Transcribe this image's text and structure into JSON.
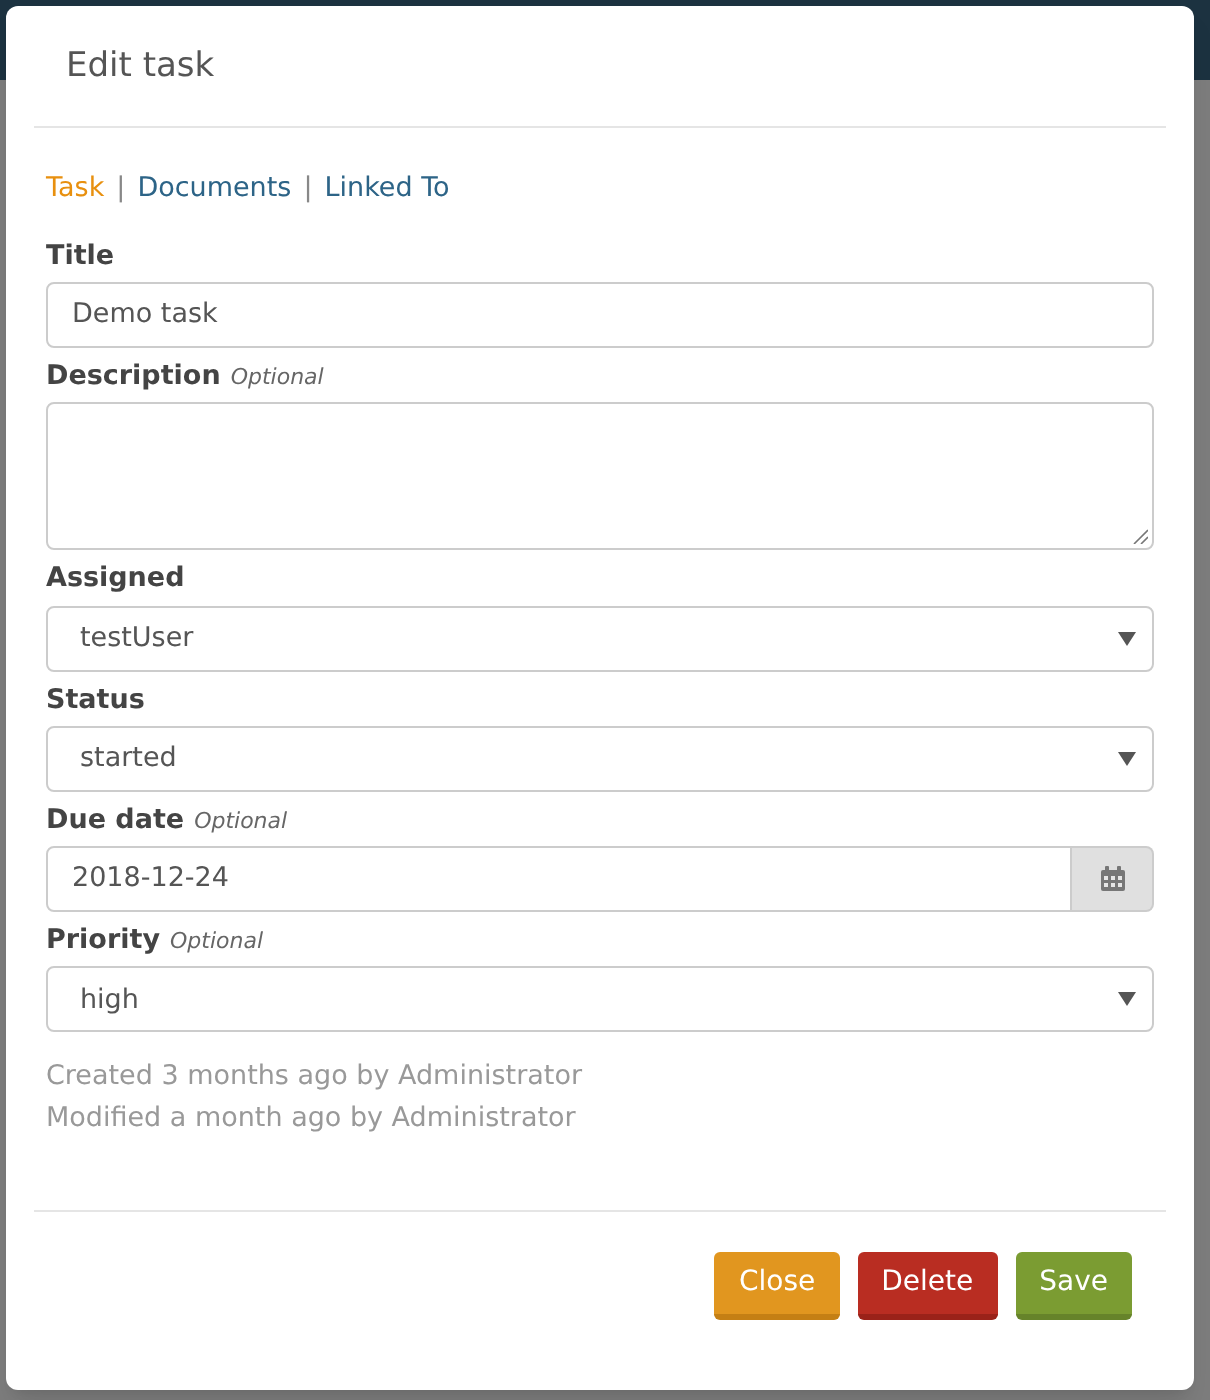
{
  "dialog": {
    "title": "Edit task"
  },
  "tabs": [
    {
      "label": "Task",
      "selected": true
    },
    {
      "label": "Documents",
      "selected": false,
      "separator": "|"
    },
    {
      "label": "Linked To",
      "selected": false,
      "separator": "|"
    }
  ],
  "fields": [
    {
      "kind": "text",
      "label": "Title",
      "value": "Demo task"
    },
    {
      "kind": "textarea",
      "label": "Description",
      "optional": "Optional"
    },
    {
      "kind": "select",
      "label": "Assigned",
      "value": "testUser"
    },
    {
      "kind": "select",
      "label": "Status",
      "value": "started"
    },
    {
      "kind": "date",
      "label": "Due date",
      "optional": "Optional",
      "value": "2018-12-24"
    },
    {
      "kind": "select",
      "label": "Priority",
      "optional": "Optional",
      "value": "high"
    }
  ],
  "history": [
    "Created 3 months ago by Administrator",
    "Modified a month ago by Administrator"
  ],
  "buttons": [
    {
      "kind": "close",
      "label": "Close"
    },
    {
      "kind": "delete",
      "label": "Delete"
    },
    {
      "kind": "save",
      "label": "Save"
    }
  ]
}
